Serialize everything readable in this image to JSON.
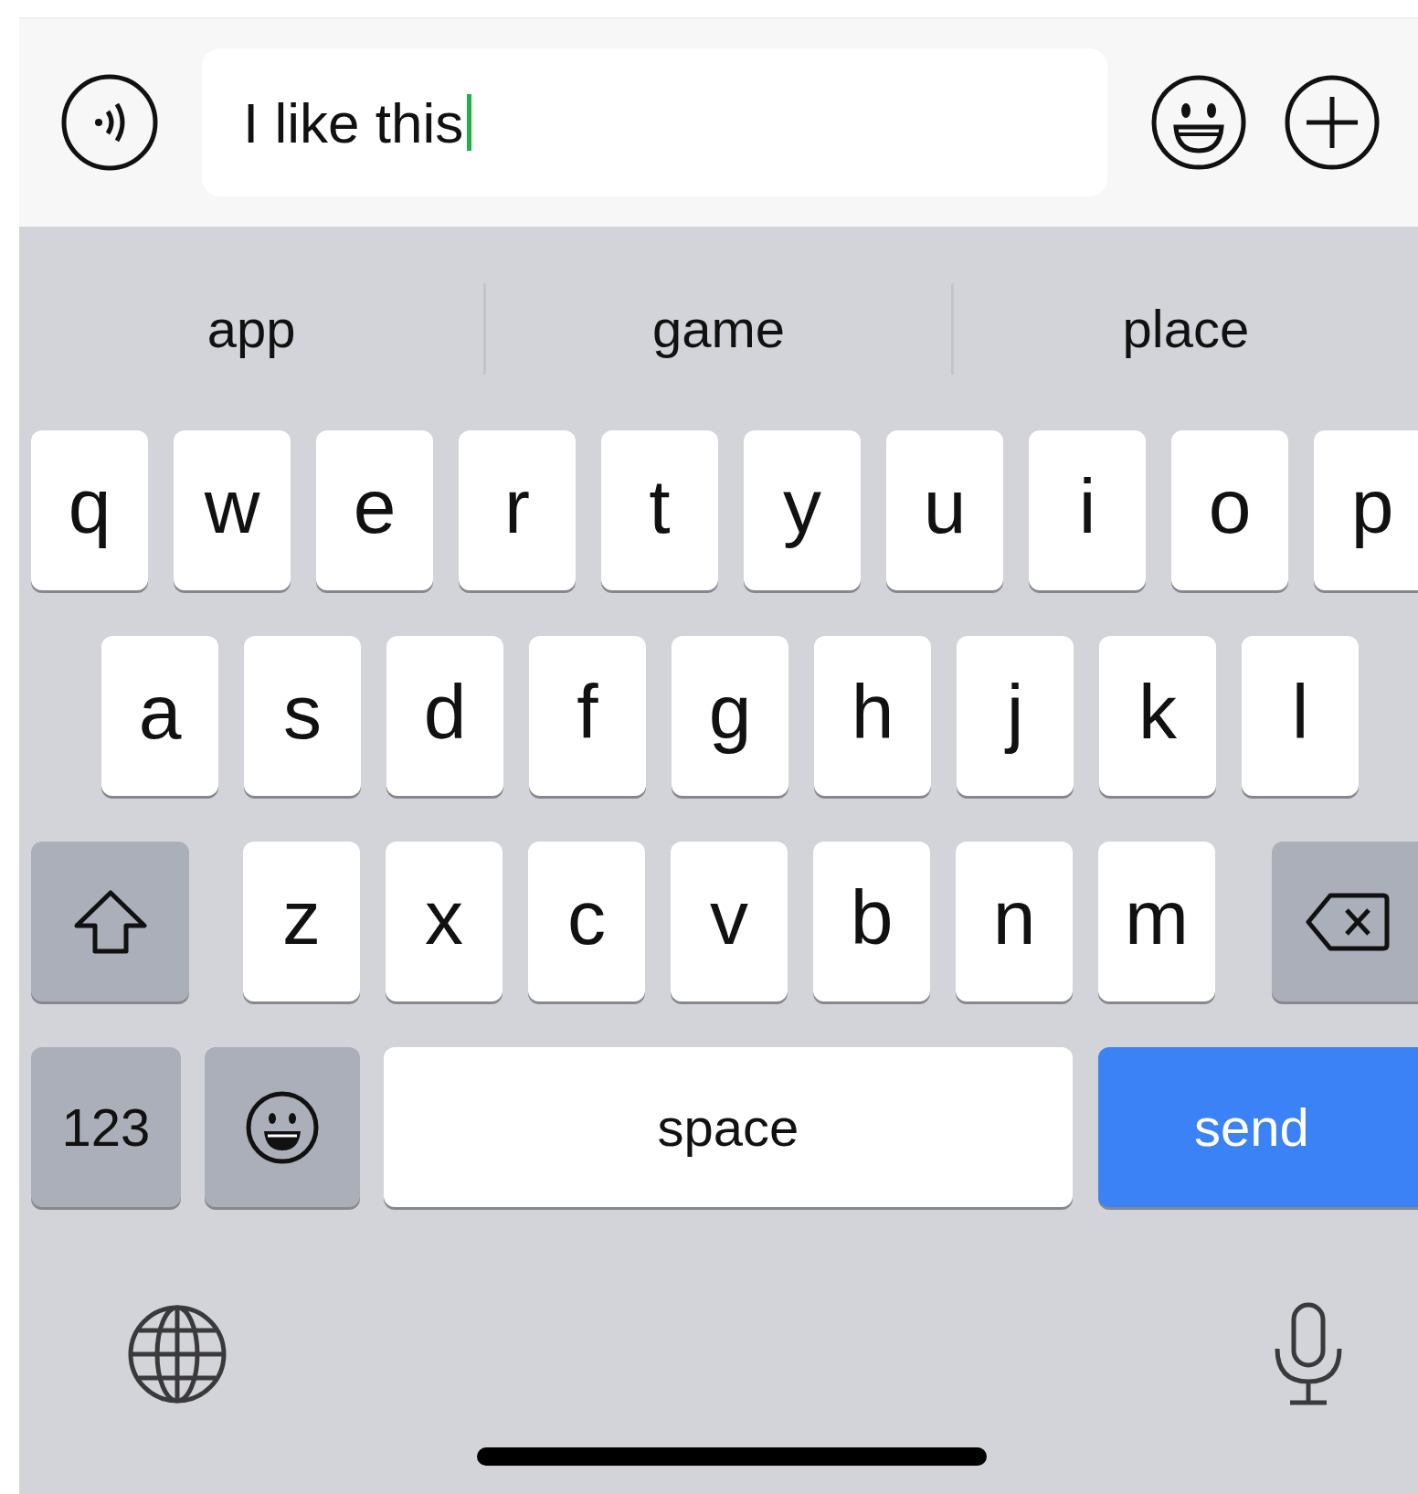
{
  "input": {
    "value": "I like this"
  },
  "suggestions": [
    {
      "label": "app"
    },
    {
      "label": "game"
    },
    {
      "label": "place"
    }
  ],
  "keyboard": {
    "letter_rows": [
      {
        "keys": [
          {
            "kind": "letter",
            "label": "q"
          },
          {
            "kind": "letter",
            "label": "w"
          },
          {
            "kind": "letter",
            "label": "e"
          },
          {
            "kind": "letter",
            "label": "r"
          },
          {
            "kind": "letter",
            "label": "t"
          },
          {
            "kind": "letter",
            "label": "y"
          },
          {
            "kind": "letter",
            "label": "u"
          },
          {
            "kind": "letter",
            "label": "i"
          },
          {
            "kind": "letter",
            "label": "o"
          },
          {
            "kind": "letter",
            "label": "p"
          }
        ]
      },
      {
        "keys": [
          {
            "kind": "letter",
            "label": "a"
          },
          {
            "kind": "letter",
            "label": "s"
          },
          {
            "kind": "letter",
            "label": "d"
          },
          {
            "kind": "letter",
            "label": "f"
          },
          {
            "kind": "letter",
            "label": "g"
          },
          {
            "kind": "letter",
            "label": "h"
          },
          {
            "kind": "letter",
            "label": "j"
          },
          {
            "kind": "letter",
            "label": "k"
          },
          {
            "kind": "letter",
            "label": "l"
          }
        ]
      },
      {
        "keys": [
          {
            "kind": "shift"
          },
          {
            "kind": "letter",
            "label": "z"
          },
          {
            "kind": "letter",
            "label": "x"
          },
          {
            "kind": "letter",
            "label": "c"
          },
          {
            "kind": "letter",
            "label": "v"
          },
          {
            "kind": "letter",
            "label": "b"
          },
          {
            "kind": "letter",
            "label": "n"
          },
          {
            "kind": "letter",
            "label": "m"
          },
          {
            "kind": "delete"
          }
        ]
      }
    ],
    "bottom_row": {
      "keys": [
        {
          "kind": "numbers",
          "label": "123"
        },
        {
          "kind": "emoji"
        },
        {
          "kind": "space",
          "label": "space"
        },
        {
          "kind": "send",
          "label": "send"
        }
      ]
    }
  }
}
